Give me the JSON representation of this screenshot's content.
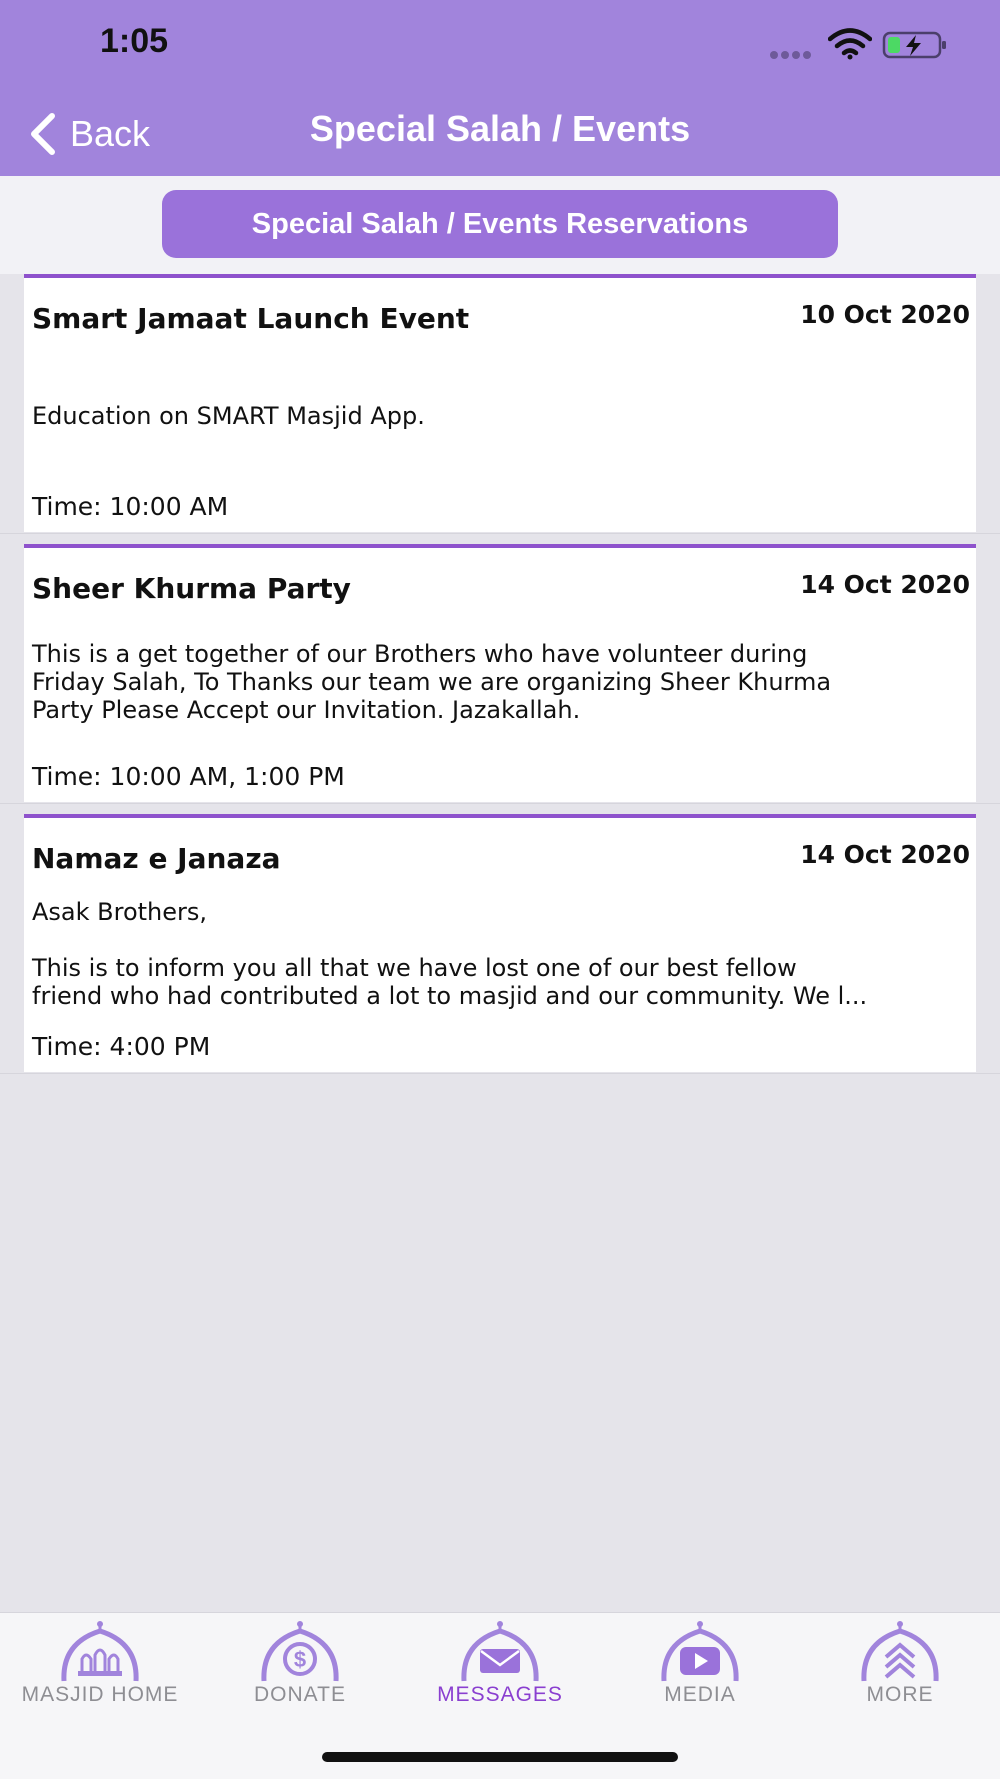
{
  "status_bar": {
    "time": "1:05"
  },
  "nav": {
    "back_label": "Back",
    "title": "Special Salah / Events"
  },
  "reservations_button": "Special Salah / Events Reservations",
  "events": [
    {
      "title": "Smart Jamaat Launch Event",
      "date": "10 Oct 2020",
      "description": "Education on SMART Masjid App.",
      "time": "Time: 10:00 AM"
    },
    {
      "title": "Sheer Khurma Party",
      "date": "14 Oct 2020",
      "description": "This is a get together of our Brothers who have volunteer during\nFriday Salah, To Thanks our team we are organizing Sheer Khurma\nParty Please Accept our Invitation. Jazakallah.",
      "time": "Time: 10:00 AM, 1:00 PM"
    },
    {
      "title": "Namaz e Janaza",
      "date": "14 Oct 2020",
      "description": "Asak Brothers,\n\nThis is to inform you all that we have lost one of our best fellow\nfriend who had contributed a lot to masjid and our community. We l...",
      "time": "Time: 4:00 PM"
    }
  ],
  "tabs": [
    {
      "label": "MASJID HOME",
      "icon": "masjid-home-icon"
    },
    {
      "label": "DONATE",
      "icon": "dollar-icon"
    },
    {
      "label": "MESSAGES",
      "icon": "envelope-icon",
      "active": true
    },
    {
      "label": "MEDIA",
      "icon": "play-icon"
    },
    {
      "label": "MORE",
      "icon": "chevrons-up-icon"
    }
  ],
  "colors": {
    "header": "#a184dc",
    "accent": "#8e52cc",
    "active_tab": "#8a3fd0"
  }
}
